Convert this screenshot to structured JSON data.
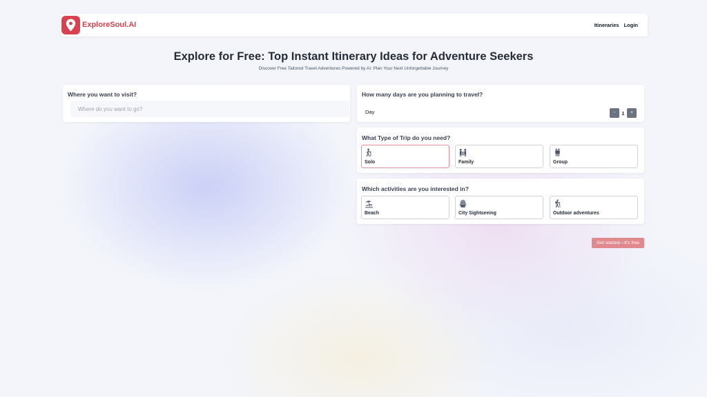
{
  "brand": {
    "name": "ExploreSoul.AI",
    "color": "#d9414e"
  },
  "nav": {
    "itineraries": "Itineraries",
    "login": "Login"
  },
  "hero": {
    "title": "Explore for Free: Top Instant Itinerary Ideas for Adventure Seekers",
    "subtitle": "Discover Free Tailored Travel Adventures Powered by AI: Plan Your Next Unforgettable Journey"
  },
  "destination": {
    "question": "Where you want to visit?",
    "placeholder": "Where do you want to go?",
    "value": ""
  },
  "days": {
    "question": "How many days are you planning to travel?",
    "unit": "Day",
    "minus": "-",
    "plus": "+",
    "value": "1"
  },
  "trip_type": {
    "question": "What Type of Trip do you need?",
    "options": [
      {
        "label": "Solo",
        "icon": "solo-traveler-icon",
        "selected": true
      },
      {
        "label": "Family",
        "icon": "family-icon",
        "selected": false
      },
      {
        "label": "Group",
        "icon": "group-icon",
        "selected": false
      }
    ]
  },
  "activities": {
    "question": "Which activities are you interested in?",
    "options": [
      {
        "label": "Beach",
        "icon": "beach-icon",
        "selected": false
      },
      {
        "label": "City Sightseeing",
        "icon": "pagoda-icon",
        "selected": false
      },
      {
        "label": "Outdoor adventures",
        "icon": "hiker-icon",
        "selected": false
      }
    ]
  },
  "cta": {
    "label": "Get started—it's free",
    "color": "#e0898f"
  }
}
